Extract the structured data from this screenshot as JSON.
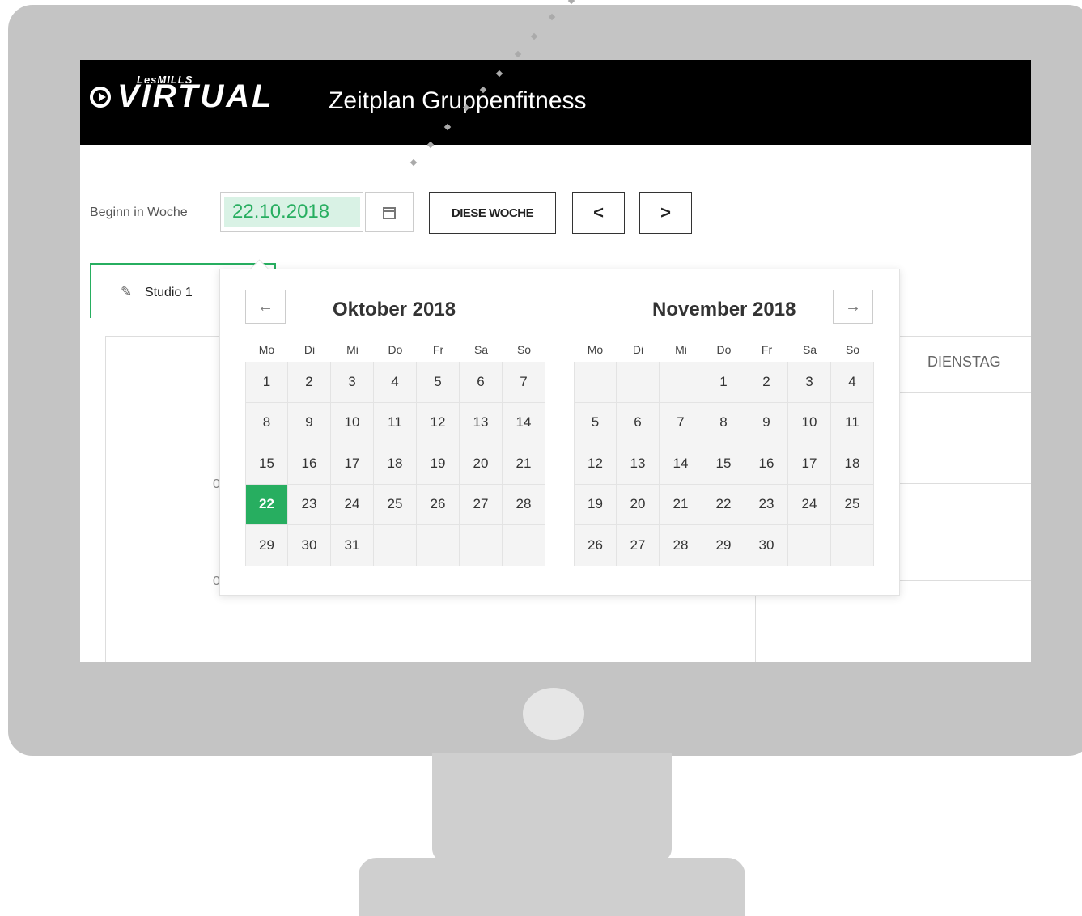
{
  "app": {
    "logo_top": "LesMILLS",
    "logo_main": "VIRTUAL",
    "title": "Zeitplan Gruppenfitness"
  },
  "toolbar": {
    "label": "Beginn in Woche",
    "date_value": "22.10.2018",
    "this_week_label": "DIESE WOCHE",
    "prev_label": "<",
    "next_label": ">"
  },
  "tabs": [
    {
      "label": "Studio 1"
    }
  ],
  "table": {
    "visible_column_header": "DIENSTAG",
    "time_stub_1": "0",
    "time_stub_2": "0"
  },
  "datepicker": {
    "prev_arrow": "←",
    "next_arrow": "→",
    "weekdays": [
      "Mo",
      "Di",
      "Mi",
      "Do",
      "Fr",
      "Sa",
      "So"
    ],
    "months": [
      {
        "title": "Oktober 2018",
        "weeks": [
          [
            "1",
            "2",
            "3",
            "4",
            "5",
            "6",
            "7"
          ],
          [
            "8",
            "9",
            "10",
            "11",
            "12",
            "13",
            "14"
          ],
          [
            "15",
            "16",
            "17",
            "18",
            "19",
            "20",
            "21"
          ],
          [
            "22",
            "23",
            "24",
            "25",
            "26",
            "27",
            "28"
          ],
          [
            "29",
            "30",
            "31",
            "",
            "",
            "",
            ""
          ]
        ],
        "selected": "22"
      },
      {
        "title": "November 2018",
        "weeks": [
          [
            "",
            "",
            "",
            "1",
            "2",
            "3",
            "4"
          ],
          [
            "5",
            "6",
            "7",
            "8",
            "9",
            "10",
            "11"
          ],
          [
            "12",
            "13",
            "14",
            "15",
            "16",
            "17",
            "18"
          ],
          [
            "19",
            "20",
            "21",
            "22",
            "23",
            "24",
            "25"
          ],
          [
            "26",
            "27",
            "28",
            "29",
            "30",
            "",
            ""
          ]
        ],
        "selected": ""
      }
    ]
  },
  "colors": {
    "accent": "#27ae60",
    "header_bg": "#000000",
    "monitor": "#c4c4c4"
  }
}
